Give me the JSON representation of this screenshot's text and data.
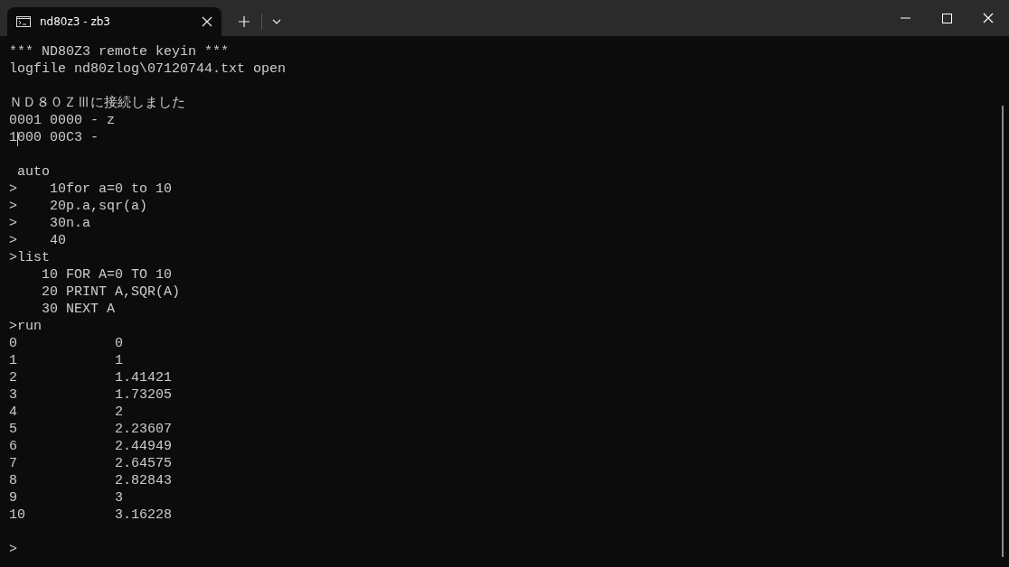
{
  "tab": {
    "title": "nd80z3 - zb3",
    "selected": true
  },
  "lines": [
    {
      "kind": "text",
      "text": "*** ND80Z3 remote keyin ***"
    },
    {
      "kind": "text",
      "text": "logfile nd80zlog\\07120744.txt open"
    },
    {
      "kind": "blank"
    },
    {
      "kind": "text",
      "text": "ＮＤ８０ＺⅢに接続しました"
    },
    {
      "kind": "text",
      "text": "0001 0000 - z"
    },
    {
      "kind": "cursor",
      "before": "1",
      "after": "000 00C3 -"
    },
    {
      "kind": "blank"
    },
    {
      "kind": "text",
      "text": " auto"
    },
    {
      "kind": "text",
      "text": ">    10for a=0 to 10"
    },
    {
      "kind": "text",
      "text": ">    20p.a,sqr(a)"
    },
    {
      "kind": "text",
      "text": ">    30n.a"
    },
    {
      "kind": "text",
      "text": ">    40"
    },
    {
      "kind": "text",
      "text": ">list"
    },
    {
      "kind": "text",
      "text": "    10 FOR A=0 TO 10"
    },
    {
      "kind": "text",
      "text": "    20 PRINT A,SQR(A)"
    },
    {
      "kind": "text",
      "text": "    30 NEXT A"
    },
    {
      "kind": "text",
      "text": ">run"
    },
    {
      "kind": "text",
      "text": "0            0"
    },
    {
      "kind": "text",
      "text": "1            1"
    },
    {
      "kind": "text",
      "text": "2            1.41421"
    },
    {
      "kind": "text",
      "text": "3            1.73205"
    },
    {
      "kind": "text",
      "text": "4            2"
    },
    {
      "kind": "text",
      "text": "5            2.23607"
    },
    {
      "kind": "text",
      "text": "6            2.44949"
    },
    {
      "kind": "text",
      "text": "7            2.64575"
    },
    {
      "kind": "text",
      "text": "8            2.82843"
    },
    {
      "kind": "text",
      "text": "9            3"
    },
    {
      "kind": "text",
      "text": "10           3.16228"
    },
    {
      "kind": "blank"
    },
    {
      "kind": "text",
      "text": ">"
    }
  ]
}
